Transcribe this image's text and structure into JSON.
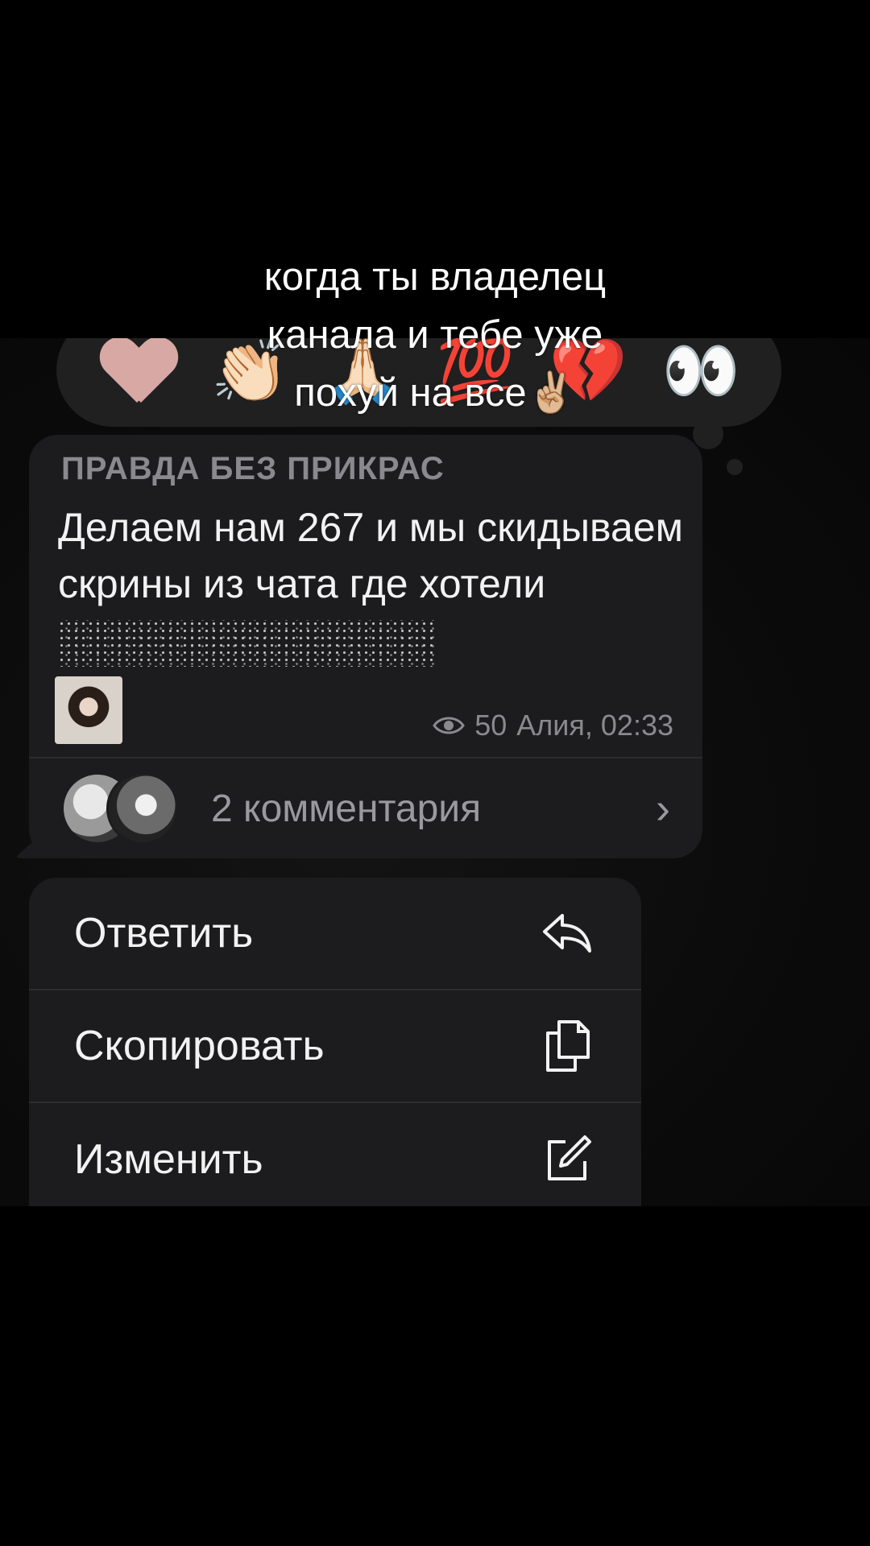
{
  "caption": {
    "line1": "когда ты владелец",
    "line2": "канала и тебе уже",
    "line3": "похуй на все✌🏼"
  },
  "reactions": [
    "heart-icon",
    "clapping-hands-icon",
    "folded-hands-icon",
    "hundred-points-icon",
    "broken-heart-icon",
    "eyes-icon"
  ],
  "reaction_glyphs": [
    "👏🏻",
    "🙏🏻",
    "💯",
    "💔",
    "👀"
  ],
  "message": {
    "channel": "ПРАВДА БЕЗ ПРИКРАС",
    "text": "Делаем нам 267 и мы скидываем скрины из чата где хотели",
    "views": "50",
    "author_time": "Алия, 02:33",
    "comments": "2 комментария",
    "chevron": "›"
  },
  "menu": {
    "reply": "Ответить",
    "copy": "Скопировать",
    "edit": "Изменить"
  }
}
